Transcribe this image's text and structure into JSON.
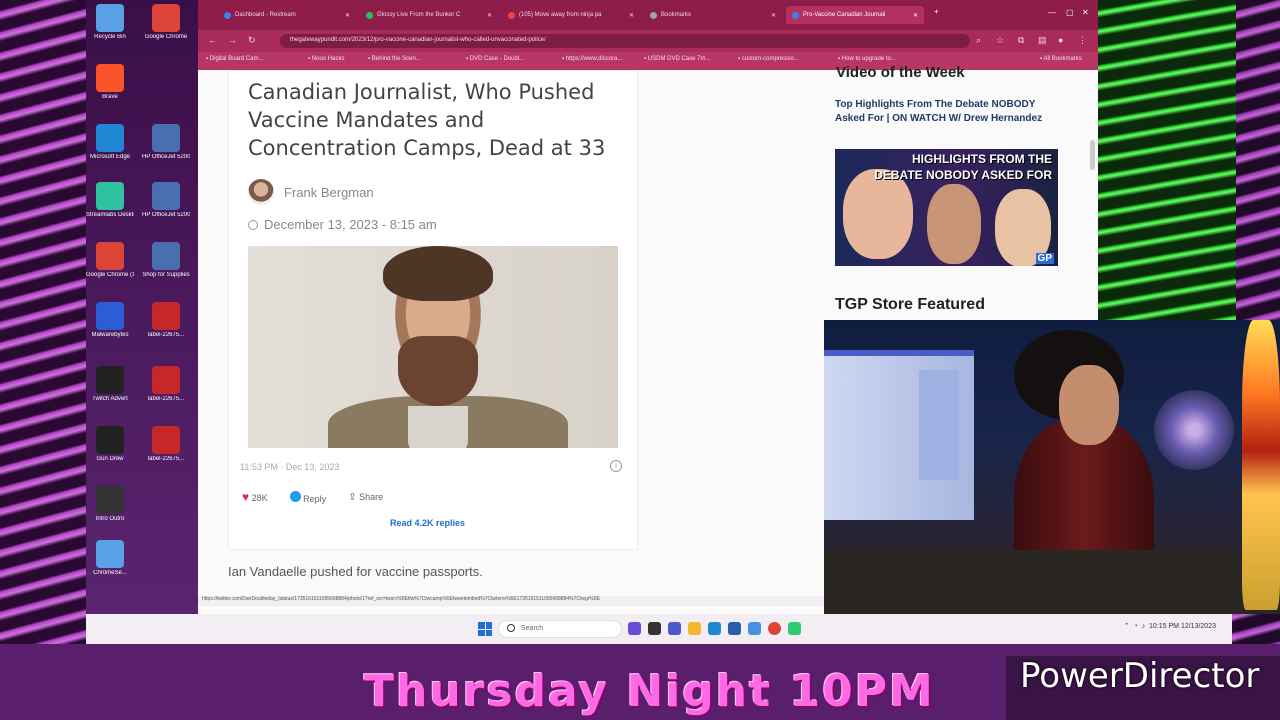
{
  "colors": {
    "tabbar": "#8f1d4a",
    "accent_pink": "#ff69e6",
    "link_blue": "#1d6fd0",
    "heart": "#e0245e"
  },
  "desktop_icons": [
    {
      "label": "Recycle Bin",
      "icon": "recycle-bin-icon"
    },
    {
      "label": "Google Chrome",
      "icon": "chrome-icon"
    },
    {
      "label": "Brave",
      "icon": "brave-icon"
    },
    {
      "label": "Microsoft Edge",
      "icon": "edge-icon"
    },
    {
      "label": "HP OfficeJet 5200 series",
      "icon": "printer-icon"
    },
    {
      "label": "Streamlabs Desktop",
      "icon": "streamlabs-icon"
    },
    {
      "label": "HP OfficeJet 5200 series",
      "icon": "printer-icon"
    },
    {
      "label": "Google Chrome (1)",
      "icon": "chrome-icon"
    },
    {
      "label": "Shop for Supplies",
      "icon": "supplies-icon"
    },
    {
      "label": "Malwarebytes",
      "icon": "malwarebytes-icon"
    },
    {
      "label": "label-22675...",
      "icon": "pdf-icon"
    },
    {
      "label": "Twitch Advert",
      "icon": "video-icon"
    },
    {
      "label": "label-22675...",
      "icon": "pdf-icon"
    },
    {
      "label": "Gun Drew",
      "icon": "video-icon"
    },
    {
      "label": "label-22675...",
      "icon": "pdf-icon"
    },
    {
      "label": "Intro Outro",
      "icon": "video-icon"
    },
    {
      "label": "ChromeSe...",
      "icon": "installer-icon"
    }
  ],
  "browser": {
    "tabs": [
      {
        "label": "Dashboard - Restream",
        "color": "#3b82f6",
        "active": false
      },
      {
        "label": "Glossy Live From the Bunker C",
        "color": "#22c55e",
        "active": false
      },
      {
        "label": "(105) Move away from ninja pa",
        "color": "#ef4444",
        "active": false
      },
      {
        "label": "Bookmarks",
        "color": "#9ca3af",
        "active": false
      },
      {
        "label": "Pro-Vaccine Canadian Journali",
        "color": "#3b82f6",
        "active": true
      }
    ],
    "new_tab": "+",
    "url": "thegatewaypundit.com/2023/12/pro-vaccine-canadian-journalist-who-called-unvaccinated-police/",
    "bookmarks": [
      "Digital Board Cam...",
      "Nooo Hacks",
      "Behind the Scen...",
      "DVD Case - Doubl...",
      "https://www.discora...",
      "USDM DVD Case 7m...",
      "custom-compressio...",
      "How to upgrade to...",
      "All Bookmarks"
    ]
  },
  "article": {
    "headline": "Canadian Journalist, Who Pushed Vaccine Mandates and Concentration Camps, Dead at 33",
    "author": "Frank Bergman",
    "date": "December 13, 2023 - 8:15 am",
    "tweet_time": "11:53 PM · Dec 13, 2023",
    "likes": "28K",
    "reply_label": "Reply",
    "share_label": "Share",
    "read_replies": "Read 4.2K replies",
    "body_text": "Ian Vandaelle pushed for vaccine passports."
  },
  "status_url": "https://twitter.com/DanDoubleday_/status/1735161511095668884/photo/1?ref_src=twsrc%5Etfw%7Ctwcamp%5Etweetembed%7Ctwterm%5E1735161511095668884%7Ctwgr%5E",
  "sidebar": {
    "section_title_cut": "Video of the Week",
    "video_link": "Top Highlights From The Debate NOBODY Asked For | ON WATCH W/ Drew Hernandez",
    "thumb_text": "HIGHLIGHTS FROM THE DEBATE NOBODY ASKED FOR",
    "thumb_badge": "GP",
    "store_title": "TGP Store Featured"
  },
  "taskbar": {
    "search_placeholder": "Search",
    "time": "10:15 PM",
    "date": "12/13/2023"
  },
  "banner": {
    "text": "Thursday Night 10PM"
  },
  "watermark": "PowerDirector"
}
